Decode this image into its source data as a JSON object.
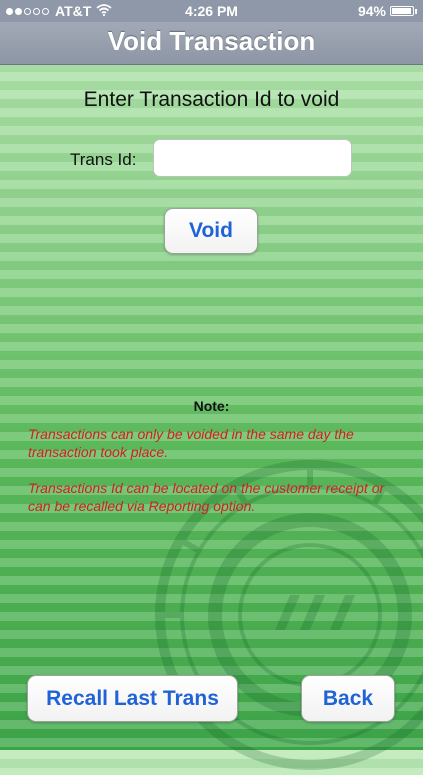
{
  "status_bar": {
    "carrier": "AT&T",
    "time": "4:26 PM",
    "battery": "94%",
    "battery_level": 0.94,
    "signal_bars_filled": 2,
    "signal_bars_total": 5
  },
  "nav": {
    "title": "Void Transaction"
  },
  "form": {
    "heading": "Enter Transaction Id to void",
    "trans_id_label": "Trans Id:",
    "trans_id_value": "",
    "trans_id_placeholder": "",
    "void_label": "Void"
  },
  "note": {
    "title": "Note:",
    "line1": "Transactions can only be voided in the same day the transaction took place.",
    "line2": "Transactions Id can be located on the customer receipt or can be recalled via Reporting option."
  },
  "footer": {
    "recall_label": "Recall Last Trans",
    "back_label": "Back"
  },
  "colors": {
    "button_text": "#1f63d6",
    "note_text": "#d21f1f",
    "nav_bar": "#8f98a8"
  },
  "icons": [
    "signal-icon",
    "wifi-icon",
    "battery-icon"
  ]
}
